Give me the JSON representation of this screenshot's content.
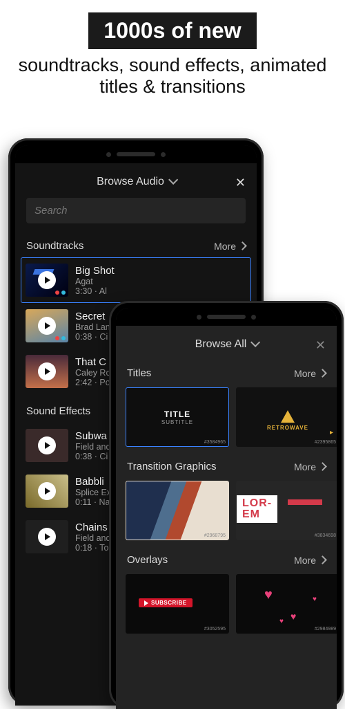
{
  "marketing": {
    "badge": "1000s of new",
    "subtitle": "soundtracks, sound effects, animated titles & transitions"
  },
  "phone1": {
    "header_title": "Browse Audio",
    "search_placeholder": "Search",
    "sections": {
      "soundtracks": {
        "title": "Soundtracks",
        "more": "More",
        "tracks": [
          {
            "title": "Big Shot",
            "artist": "Agat",
            "duration_cat": "3:30 · Al"
          },
          {
            "title": "Secret",
            "artist": "Brad Lan",
            "duration_cat": "0:38 · Ci"
          },
          {
            "title": "That C",
            "artist": "Caley Ro",
            "duration_cat": "2:42 · Po"
          }
        ]
      },
      "sfx": {
        "title": "Sound Effects",
        "tracks": [
          {
            "title": "Subwa",
            "artist": "Field and",
            "duration_cat": "0:38 · Ci"
          },
          {
            "title": "Babbli",
            "artist": "Splice Ex",
            "duration_cat": "0:11 · Na"
          },
          {
            "title": "Chains",
            "artist": "Field and",
            "duration_cat": "0:18 · To"
          }
        ]
      }
    }
  },
  "phone2": {
    "header_title": "Browse All",
    "sections": {
      "titles": {
        "label": "Titles",
        "more": "More",
        "tile1": {
          "line1": "TITLE",
          "line2": "SUBTITLE",
          "code": "#3584965"
        },
        "tile2": {
          "label": "RETROWAVE",
          "code": "#2395865"
        }
      },
      "transitions": {
        "label": "Transition Graphics",
        "more": "More",
        "tile1": {
          "code": "#2968795"
        },
        "tile2": {
          "text": "LOR-EM",
          "code": "#3834698"
        }
      },
      "overlays": {
        "label": "Overlays",
        "more": "More",
        "tile1": {
          "button": "SUBSCRIBE",
          "code": "#3052595"
        },
        "tile2": {
          "code": "#2984989"
        }
      }
    }
  }
}
